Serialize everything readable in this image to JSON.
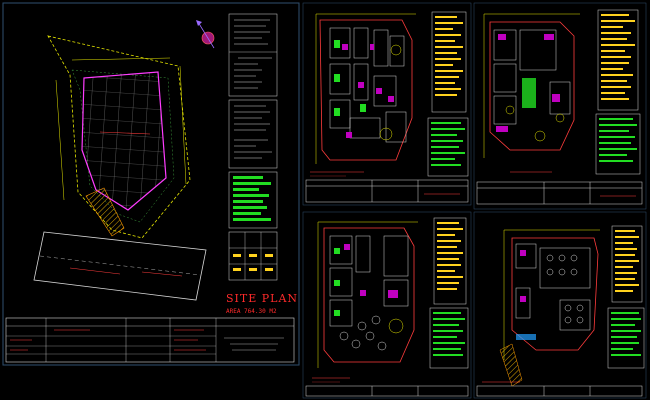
{
  "site_plan": {
    "title": "SITE PLAN",
    "area": "AREA 764.30 M2"
  },
  "colors": {
    "background": "#000000",
    "sheet_border": "#2f4f6f",
    "boundary_yellow": "#e6e600",
    "walls_red": "#ff3c3c",
    "hatch_magenta": "#c000c0",
    "legend_green": "#22dd22",
    "legend_yellow": "#ffd21e",
    "line_white": "#d8d8d8"
  },
  "sheets": [
    {
      "id": "site-plan-sheet",
      "label": "SITE PLAN"
    },
    {
      "id": "plan-sheet-top-left"
    },
    {
      "id": "plan-sheet-top-right"
    },
    {
      "id": "plan-sheet-bottom-left"
    },
    {
      "id": "plan-sheet-bottom-right"
    }
  ]
}
